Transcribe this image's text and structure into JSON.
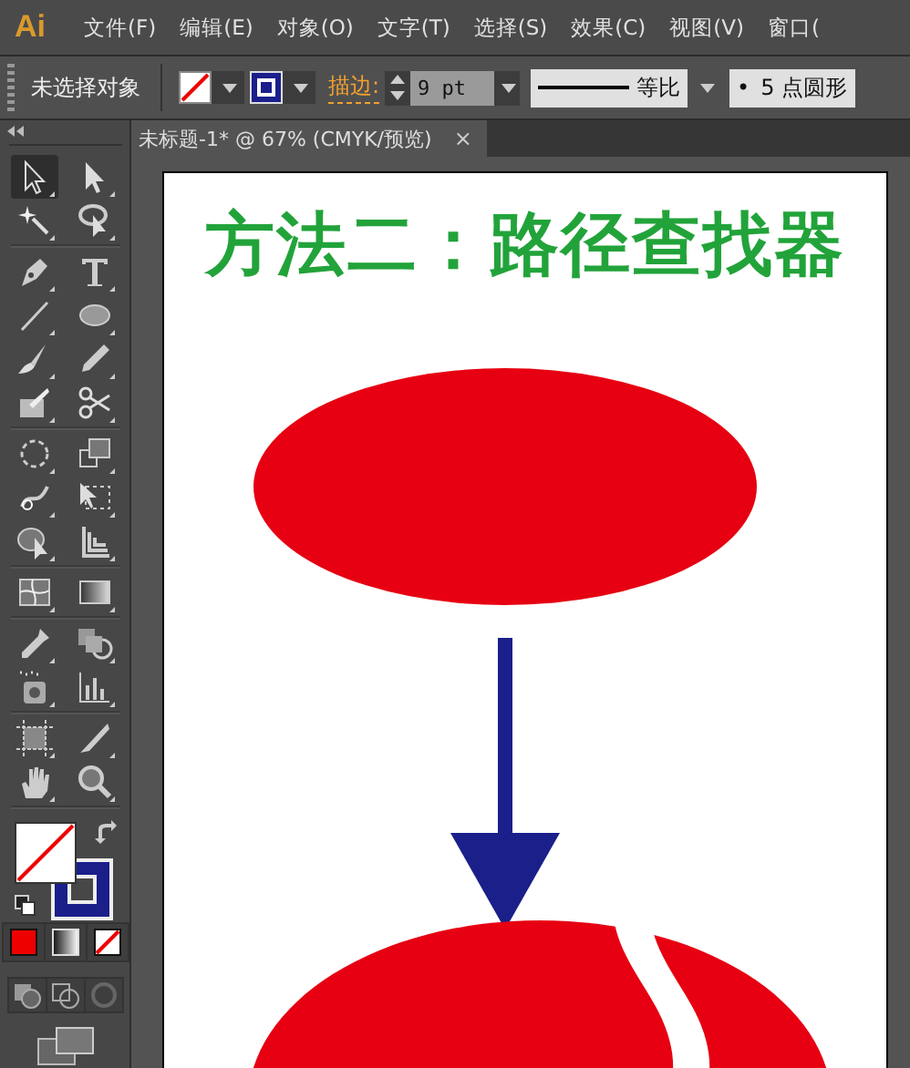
{
  "app": {
    "logo": "Ai"
  },
  "menu": [
    "文件(F)",
    "编辑(E)",
    "对象(O)",
    "文字(T)",
    "选择(S)",
    "效果(C)",
    "视图(V)",
    "窗口("
  ],
  "control_bar": {
    "selection": "未选择对象",
    "stroke_label": "描边:",
    "stroke_weight": "9 pt",
    "profile": "等比",
    "brush_dot": "•",
    "brush": "5 点圆形"
  },
  "tools": [
    {
      "kind": "selection",
      "selected": true
    },
    {
      "kind": "direct",
      "selected": false
    },
    {
      "kind": "wand",
      "selected": false
    },
    {
      "kind": "lasso",
      "selected": false
    },
    {
      "kind": "pen",
      "selected": false
    },
    {
      "kind": "type",
      "selected": false
    },
    {
      "kind": "line",
      "selected": false
    },
    {
      "kind": "ellipse",
      "selected": false
    },
    {
      "kind": "brush",
      "selected": false
    },
    {
      "kind": "pencil",
      "selected": false
    },
    {
      "kind": "blob",
      "selected": false
    },
    {
      "kind": "scissors",
      "selected": false
    },
    {
      "kind": "rotate",
      "selected": false
    },
    {
      "kind": "scale",
      "selected": false
    },
    {
      "kind": "warp",
      "selected": false
    },
    {
      "kind": "transform",
      "selected": false
    },
    {
      "kind": "builder",
      "selected": false
    },
    {
      "kind": "perspective",
      "selected": false
    },
    {
      "kind": "mesh",
      "selected": false
    },
    {
      "kind": "gradient",
      "selected": false
    },
    {
      "kind": "eyedropper",
      "selected": false
    },
    {
      "kind": "blend",
      "selected": false
    },
    {
      "kind": "sprayer",
      "selected": false
    },
    {
      "kind": "graph",
      "selected": false
    },
    {
      "kind": "artboard",
      "selected": false
    },
    {
      "kind": "slice",
      "selected": false
    },
    {
      "kind": "hand",
      "selected": false
    },
    {
      "kind": "zoom",
      "selected": false
    }
  ],
  "document_tab": {
    "title": "未标题-1* @ 67% (CMYK/预览)",
    "close": "×"
  },
  "artwork": {
    "title": "方法二：路径查找器"
  }
}
